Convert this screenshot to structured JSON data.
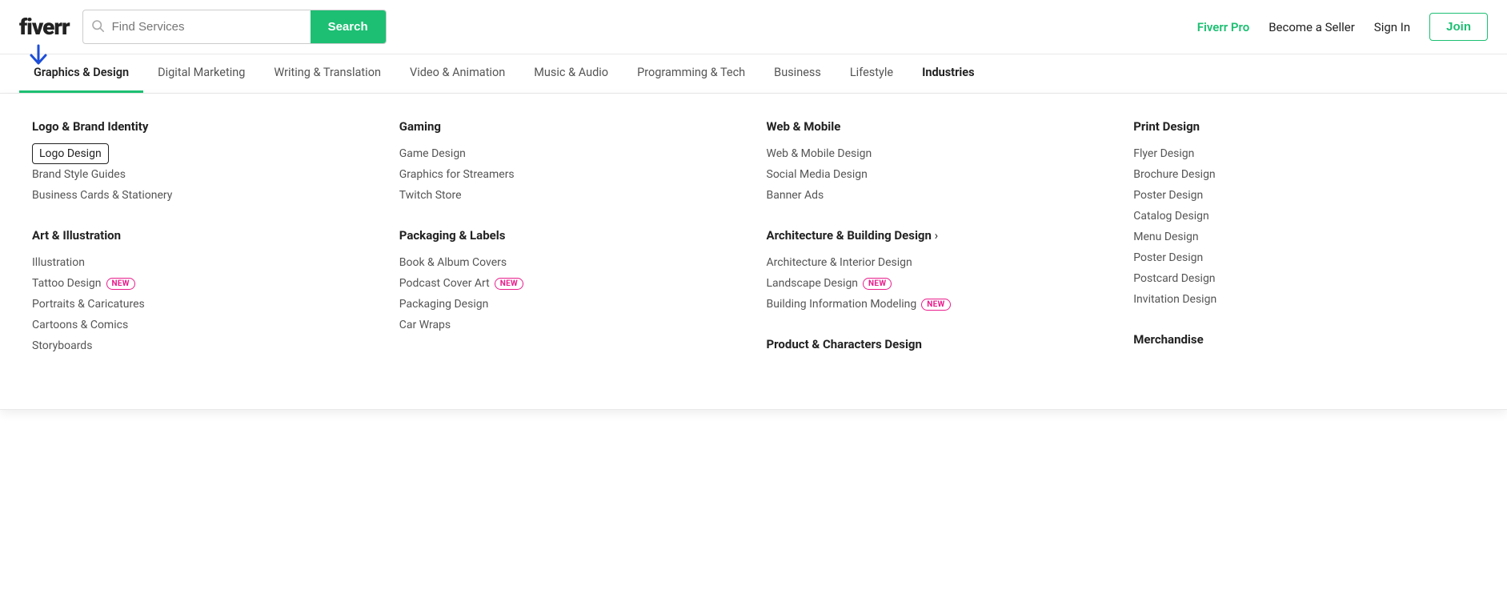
{
  "header": {
    "logo": "fiverr",
    "search_placeholder": "Find Services",
    "search_button": "Search",
    "fiverr_pro": "Fiverr Pro",
    "become_seller": "Become a Seller",
    "sign_in": "Sign In",
    "join": "Join"
  },
  "nav": {
    "items": [
      {
        "label": "Graphics & Design",
        "active": true
      },
      {
        "label": "Digital Marketing",
        "active": false
      },
      {
        "label": "Writing & Translation",
        "active": false
      },
      {
        "label": "Video & Animation",
        "active": false
      },
      {
        "label": "Music & Audio",
        "active": false
      },
      {
        "label": "Programming & Tech",
        "active": false
      },
      {
        "label": "Business",
        "active": false
      },
      {
        "label": "Lifestyle",
        "active": false
      },
      {
        "label": "Industries",
        "active": false,
        "bold": true
      }
    ]
  },
  "dropdown": {
    "columns": [
      {
        "sections": [
          {
            "title": "Logo & Brand Identity",
            "items": [
              {
                "label": "Logo Design",
                "highlighted": true
              },
              {
                "label": "Brand Style Guides"
              },
              {
                "label": "Business Cards & Stationery"
              }
            ]
          },
          {
            "title": "Art & Illustration",
            "items": [
              {
                "label": "Illustration"
              },
              {
                "label": "Tattoo Design",
                "new": true
              },
              {
                "label": "Portraits & Caricatures"
              },
              {
                "label": "Cartoons & Comics"
              },
              {
                "label": "Storyboards"
              }
            ]
          }
        ]
      },
      {
        "sections": [
          {
            "title": "Gaming",
            "items": [
              {
                "label": "Game Design"
              },
              {
                "label": "Graphics for Streamers"
              },
              {
                "label": "Twitch Store"
              }
            ]
          },
          {
            "title": "Packaging & Labels",
            "items": [
              {
                "label": "Book & Album Covers"
              },
              {
                "label": "Podcast Cover Art",
                "new": true
              },
              {
                "label": "Packaging Design"
              },
              {
                "label": "Car Wraps"
              }
            ]
          }
        ]
      },
      {
        "sections": [
          {
            "title": "Web & Mobile",
            "items": [
              {
                "label": "Web & Mobile Design"
              },
              {
                "label": "Social Media Design"
              },
              {
                "label": "Banner Ads"
              }
            ]
          },
          {
            "title": "Architecture & Building Design",
            "arrow": true,
            "items": [
              {
                "label": "Architecture & Interior Design"
              },
              {
                "label": "Landscape Design",
                "new": true
              },
              {
                "label": "Building Information Modeling",
                "new": true
              }
            ]
          },
          {
            "title": "Product & Characters Design",
            "items": []
          }
        ]
      },
      {
        "sections": [
          {
            "title": "Print Design",
            "items": [
              {
                "label": "Flyer Design"
              },
              {
                "label": "Brochure Design"
              },
              {
                "label": "Poster Design"
              },
              {
                "label": "Catalog Design"
              },
              {
                "label": "Menu Design"
              },
              {
                "label": "Poster Design"
              },
              {
                "label": "Postcard Design"
              },
              {
                "label": "Invitation Design"
              }
            ]
          },
          {
            "title": "Merchandise",
            "items": []
          }
        ]
      }
    ]
  }
}
